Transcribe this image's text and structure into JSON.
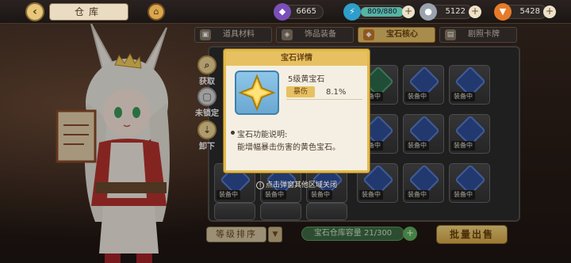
{
  "topbar": {
    "back_icon": "back-arrow-icon",
    "title": "仓库",
    "home_icon": "home-icon",
    "crystal": "6665",
    "stamina": "809/880",
    "coins": "5122",
    "carrots": "5428",
    "plus": "+"
  },
  "tabs": [
    {
      "label": "道具材料",
      "active": false
    },
    {
      "label": "饰品装备",
      "active": false
    },
    {
      "label": "宝石核心",
      "active": true
    },
    {
      "label": "剧照卡牌",
      "active": false
    }
  ],
  "side_buttons": {
    "obtain": "获取",
    "unlock": "未锁定",
    "unload": "卸下"
  },
  "inventory": {
    "slot_tag": "装备中"
  },
  "popup": {
    "title": "宝石详情",
    "gem_name": "5级黄宝石",
    "stat_label": "暴伤",
    "stat_value": "8.1%",
    "desc_title": "宝石功能说明:",
    "desc_text": "能增幅暴击伤害的黄色宝石。"
  },
  "close_hint": "点击弹窗其他区域关闭",
  "bottom": {
    "sort_label": "等级排序",
    "sort_arrow": "▼",
    "capacity": "宝石仓库容量 21/300",
    "capacity_plus": "+",
    "bulk_sell": "批量出售"
  },
  "colors": {
    "accent_gold": "#e7c161",
    "popup_bg": "#f4efe2",
    "panel_bg": "#2b2b2d",
    "capacity_green": "#3d6b43"
  }
}
